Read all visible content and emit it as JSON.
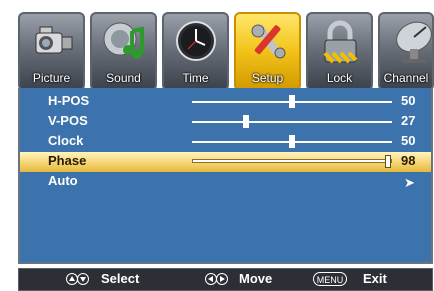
{
  "tabs": [
    {
      "label": "Picture",
      "icon": "camcorder-icon",
      "active": false
    },
    {
      "label": "Sound",
      "icon": "speaker-note-icon",
      "active": false
    },
    {
      "label": "Time",
      "icon": "clock-icon",
      "active": false
    },
    {
      "label": "Setup",
      "icon": "tools-icon",
      "active": true
    },
    {
      "label": "Lock",
      "icon": "padlock-icon",
      "active": false
    },
    {
      "label": "Channel",
      "icon": "satellite-dish-icon",
      "active": false
    }
  ],
  "menu": {
    "rows": [
      {
        "label": "H-POS",
        "value": "50",
        "level": 50
      },
      {
        "label": "V-POS",
        "value": "27",
        "level": 27
      },
      {
        "label": "Clock",
        "value": "50",
        "level": 50
      },
      {
        "label": "Phase",
        "value": "98",
        "level": 98,
        "selected": true
      },
      {
        "label": "Auto",
        "arrow": "➤"
      }
    ]
  },
  "footer": {
    "select_label": "Select",
    "move_label": "Move",
    "menu_key": "MENU",
    "exit_label": "Exit"
  },
  "colors": {
    "panel": "#3c73ad",
    "selected_row": "#f6d77a",
    "active_tab": "#f2c21a"
  }
}
